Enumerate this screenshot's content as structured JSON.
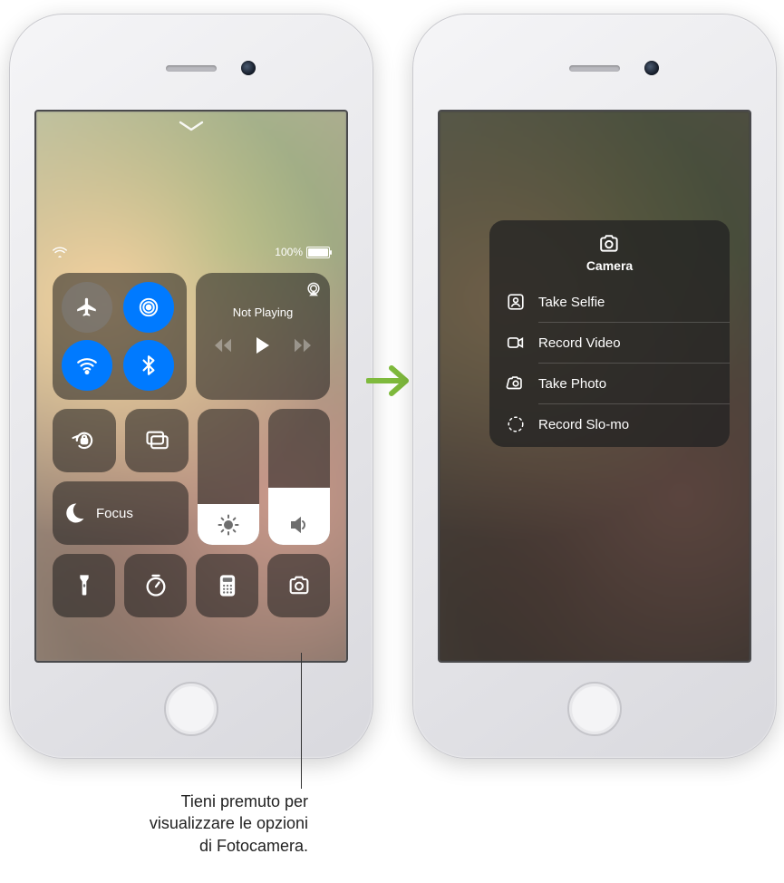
{
  "status": {
    "battery_pct": "100%"
  },
  "cc": {
    "media_not_playing": "Not Playing",
    "focus_label": "Focus",
    "accent_blue": "#007aff"
  },
  "camera_menu": {
    "title": "Camera",
    "items": [
      {
        "icon": "selfie-person-icon",
        "label": "Take Selfie"
      },
      {
        "icon": "video-icon",
        "label": "Record Video"
      },
      {
        "icon": "camera-icon",
        "label": "Take Photo"
      },
      {
        "icon": "slowmo-icon",
        "label": "Record Slo-mo"
      }
    ]
  },
  "callout": {
    "line1": "Tieni premuto per",
    "line2": "visualizzare le opzioni",
    "line3": "di Fotocamera."
  }
}
